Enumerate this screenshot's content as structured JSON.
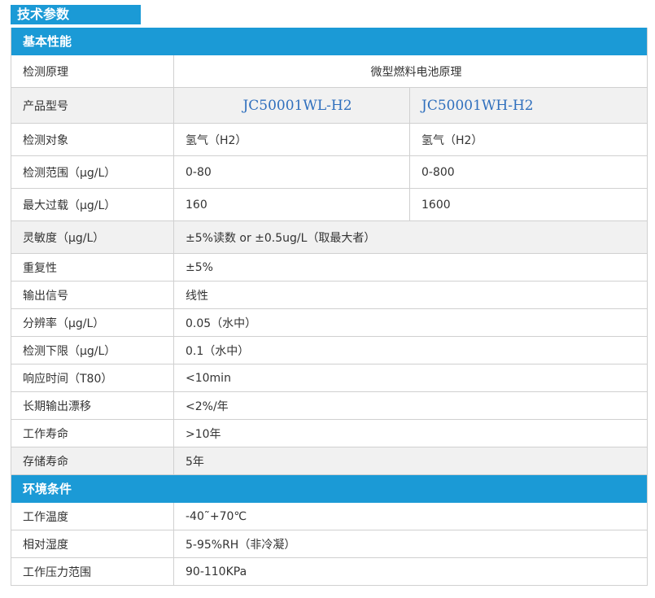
{
  "title": "技术参数",
  "basic": {
    "header": "基本性能",
    "principle": {
      "label": "检测原理",
      "value": "微型燃料电池原理"
    },
    "model": {
      "label": "产品型号",
      "a": "JC50001WL-H2",
      "b": "JC50001WH-H2"
    },
    "target": {
      "label": "检测对象",
      "a": "氢气（H2）",
      "b": "氢气（H2）"
    },
    "range": {
      "label": "检测范围（μg/L）",
      "a": "0-80",
      "b": "0-800"
    },
    "overload": {
      "label": "最大过载（μg/L）",
      "a": "160",
      "b": "1600"
    },
    "sensitivity": {
      "label": "灵敏度（μg/L）",
      "value": "±5%读数 or ±0.5ug/L（取最大者）"
    },
    "repeatability": {
      "label": "重复性",
      "value": "±5%"
    },
    "output": {
      "label": "输出信号",
      "value": "线性"
    },
    "resolution": {
      "label": "分辨率（μg/L）",
      "value": "0.05（水中）"
    },
    "lower_limit": {
      "label": "检测下限（μg/L）",
      "value": "0.1（水中）"
    },
    "response": {
      "label": "响应时间（T80）",
      "value": "<10min"
    },
    "drift": {
      "label": "长期输出漂移",
      "value": "<2%/年"
    },
    "working_life": {
      "label": "工作寿命",
      "value": ">10年"
    },
    "storage_life": {
      "label": "存储寿命",
      "value": "5年"
    }
  },
  "env": {
    "header": "环境条件",
    "temperature": {
      "label": "工作温度",
      "value": "-40˜+70℃"
    },
    "humidity": {
      "label": "相对湿度",
      "value": "5-95%RH（非冷凝）"
    },
    "pressure": {
      "label": "工作压力范围",
      "value": "90-110KPa"
    }
  }
}
